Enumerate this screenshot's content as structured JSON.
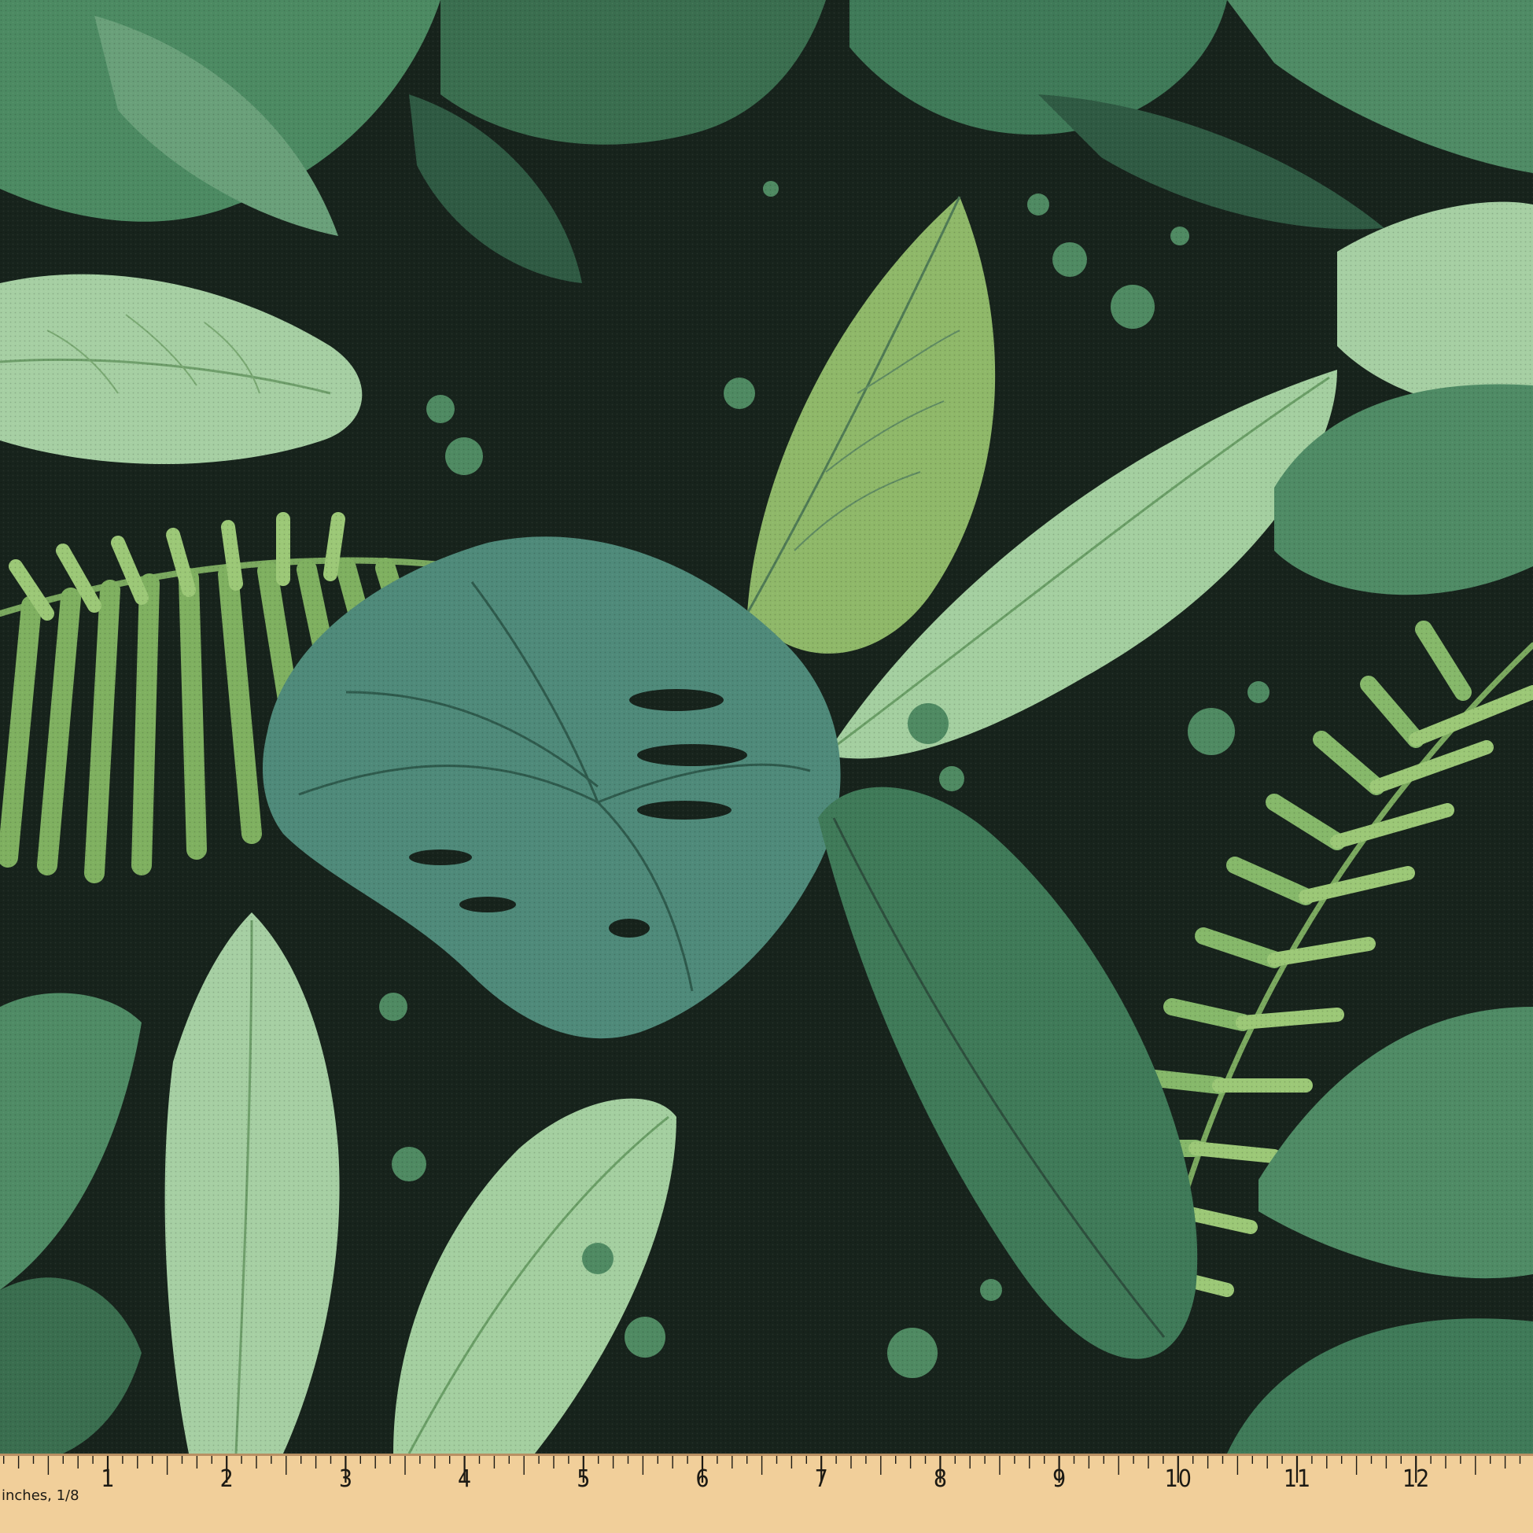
{
  "image": {
    "subject": "tropical-leaf-fabric-swatch",
    "colors": {
      "background": "#17231c",
      "dark_leaf": "#2f5a43",
      "mid_leaf": "#3f7a58",
      "sage_leaf": "#5e9a73",
      "light_leaf": "#8fbc8f",
      "pale_leaf": "#a9d0a6",
      "lime_leaf": "#8fb869",
      "monstera": "#4f8a7a",
      "vein_dark": "#2d4f3d",
      "vein_light": "#b8d8a8",
      "ruler_wood": "#f1cf9a",
      "ruler_ink": "#1c1a14"
    }
  },
  "ruler": {
    "unit_label": "inches, 1/8",
    "numbers": [
      "1",
      "2",
      "3",
      "4",
      "5",
      "6",
      "7",
      "8",
      "9",
      "10",
      "11",
      "12",
      "1"
    ]
  }
}
